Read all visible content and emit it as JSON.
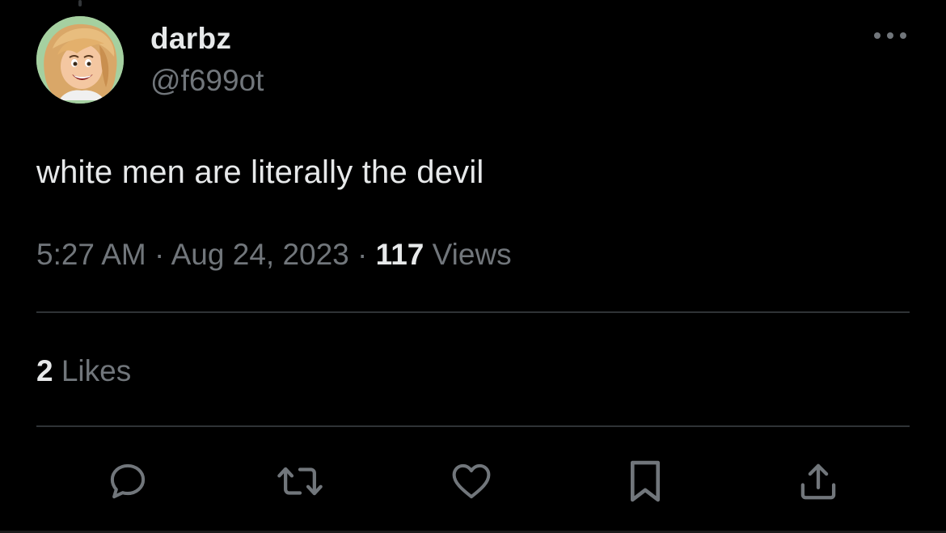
{
  "tweet": {
    "author": {
      "display_name": "darbz",
      "handle": "@f699ot",
      "avatar_icon": "cartoon-avatar"
    },
    "text": "white men are literally the devil",
    "time": "5:27 AM",
    "separator": "·",
    "date": "Aug 24, 2023",
    "views_count": "117",
    "views_label": "Views",
    "likes_count": "2",
    "likes_label": "Likes"
  },
  "actions": {
    "reply_icon": "reply-icon",
    "retweet_icon": "retweet-icon",
    "like_icon": "heart-icon",
    "bookmark_icon": "bookmark-icon",
    "share_icon": "share-icon",
    "more_icon": "more-horizontal-icon"
  },
  "colors": {
    "background": "#000000",
    "primary_text": "#e7e9ea",
    "secondary_text": "#71767b",
    "divider": "#2f3336"
  }
}
